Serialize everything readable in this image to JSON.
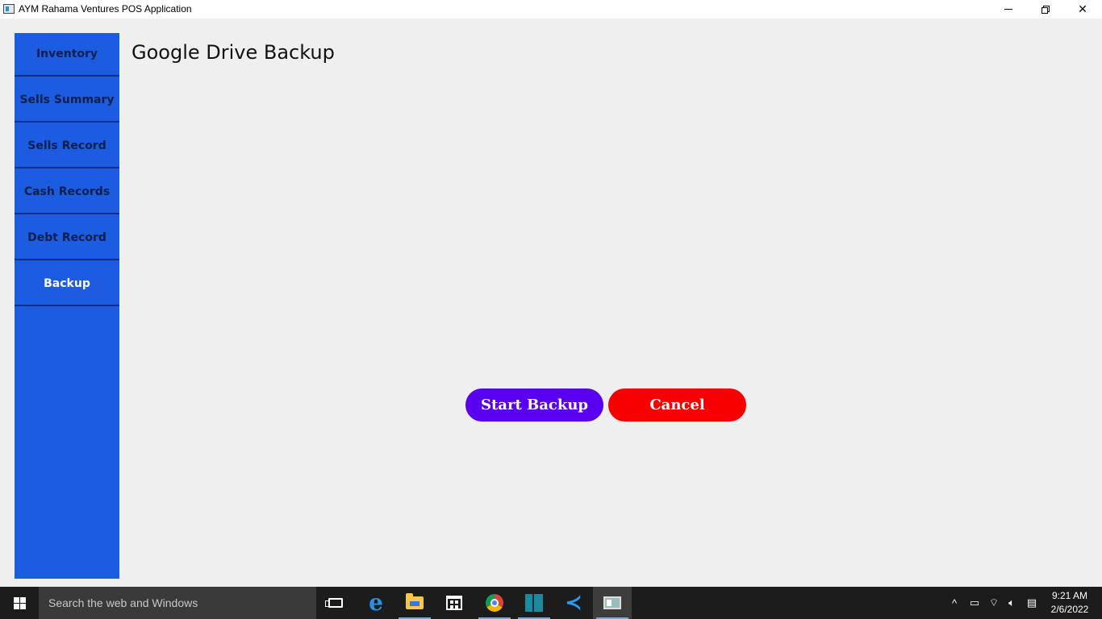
{
  "window": {
    "title": "AYM Rahama Ventures POS Application",
    "icon": "app-window-icon",
    "controls": [
      "minimize-icon",
      "restore-icon",
      "close-icon"
    ]
  },
  "sidebar": {
    "items": [
      {
        "label": "Inventory",
        "active": false
      },
      {
        "label": "Sells Summary",
        "active": false
      },
      {
        "label": "Sells Record",
        "active": false
      },
      {
        "label": "Cash Records",
        "active": false
      },
      {
        "label": "Debt Record",
        "active": false
      },
      {
        "label": "Backup",
        "active": true
      }
    ]
  },
  "main": {
    "title": "Google Drive Backup",
    "start_label": "Start Backup",
    "cancel_label": "Cancel"
  },
  "colors": {
    "sidebar": "#1b5ce0",
    "start_button": "#5a00f0",
    "cancel_button": "#f80000",
    "background": "#efefef",
    "taskbar": "#1c1c1c"
  },
  "taskbar": {
    "search_placeholder": "Search the web and Windows",
    "icons": [
      "windows-start-icon",
      "task-view-icon",
      "edge-icon",
      "file-explorer-icon",
      "store-icon",
      "chrome-icon",
      "app-icon",
      "vscode-icon",
      "pos-app-icon"
    ],
    "time": "9:21 AM",
    "date": "2/6/2022"
  }
}
